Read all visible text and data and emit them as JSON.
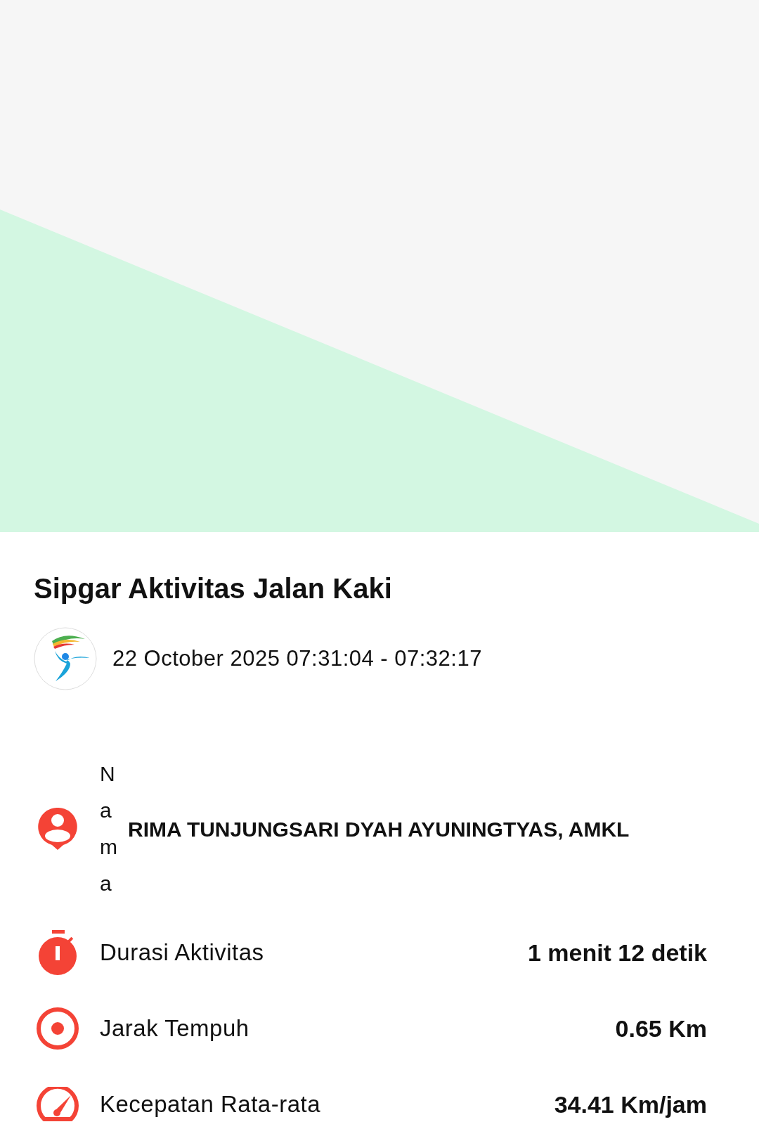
{
  "title": "Sipgar Aktivitas Jalan Kaki",
  "date_range": "22 October 2025 07:31:04 - 07:32:17",
  "info_rows": [
    {
      "kind": "name",
      "label": "Nama",
      "value": "RIMA TUNJUNGSARI DYAH AYUNINGTYAS, AMKL"
    },
    {
      "kind": "duration",
      "label": "Durasi Aktivitas",
      "value": "1 menit 12 detik"
    },
    {
      "kind": "distance",
      "label": "Jarak Tempuh",
      "value": "0.65 Km"
    },
    {
      "kind": "speed",
      "label": "Kecepatan Rata-rata",
      "value": "34.41 Km/jam"
    }
  ]
}
